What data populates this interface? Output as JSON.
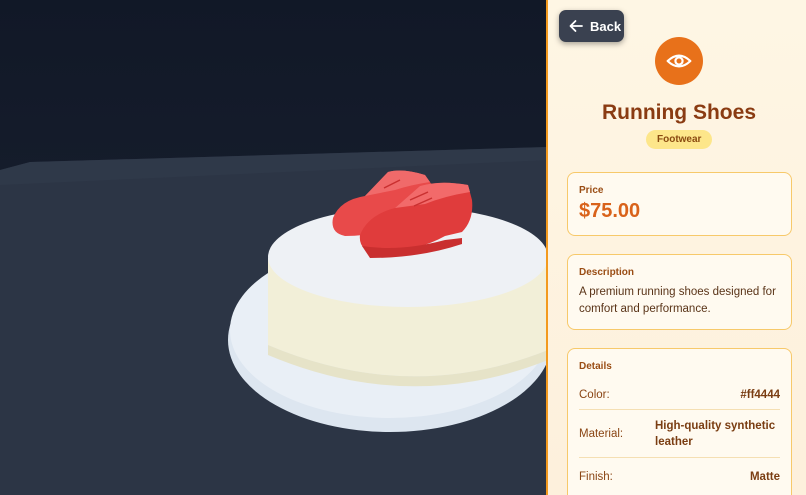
{
  "nav": {
    "back_label": "Back"
  },
  "product": {
    "name": "Running Shoes",
    "category": "Footwear",
    "color_hex": "#ff4444"
  },
  "price": {
    "label": "Price",
    "value": "$75.00"
  },
  "description": {
    "label": "Description",
    "text": "A premium running shoes designed for comfort and performance."
  },
  "details": {
    "label": "Details",
    "rows": [
      {
        "key": "Color:",
        "value": "#ff4444"
      },
      {
        "key": "Material:",
        "value": "High-quality synthetic leather"
      },
      {
        "key": "Finish:",
        "value": "Matte"
      }
    ]
  },
  "icons": {
    "back": "arrow-left-icon",
    "view": "eye-icon"
  },
  "colors": {
    "accent": "#e8711a",
    "panel_border": "#f39a1e",
    "title": "#8a3b12"
  }
}
